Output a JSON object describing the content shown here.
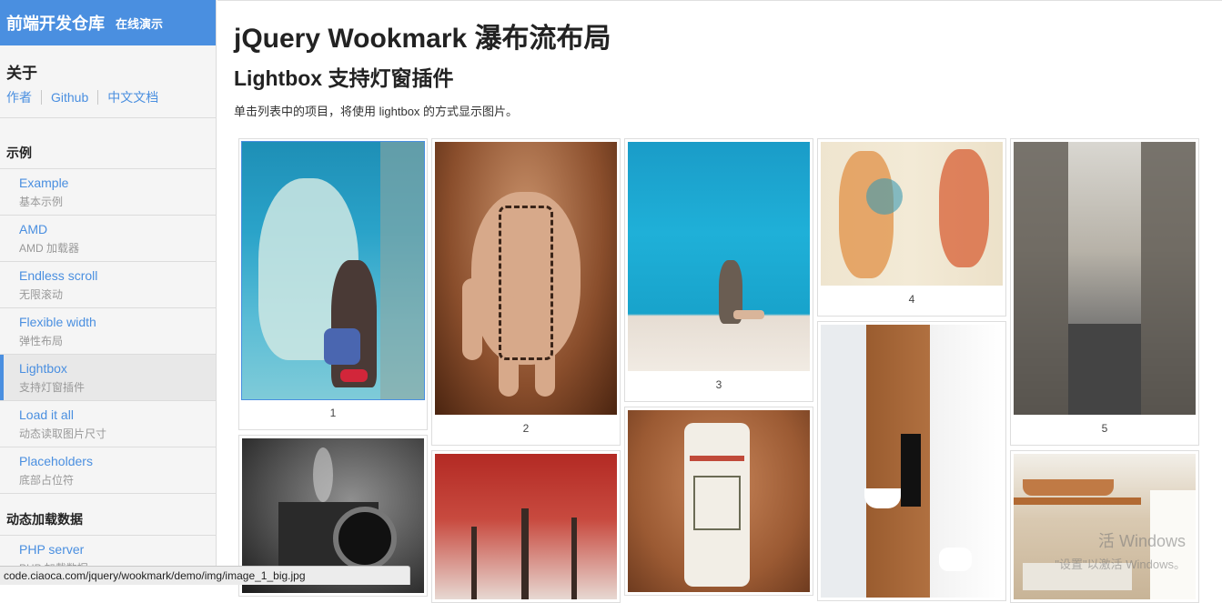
{
  "brand": {
    "title": "前端开发仓库",
    "subtitle": "在线演示"
  },
  "about": {
    "title": "关于",
    "links": [
      "作者",
      "Github",
      "中文文档"
    ]
  },
  "sections": [
    {
      "title": "示例"
    },
    {
      "title": "动态加载数据"
    }
  ],
  "nav": [
    {
      "title": "Example",
      "sub": "基本示例"
    },
    {
      "title": "AMD",
      "sub": "AMD 加载器"
    },
    {
      "title": "Endless scroll",
      "sub": "无限滚动"
    },
    {
      "title": "Flexible width",
      "sub": "弹性布局"
    },
    {
      "title": "Lightbox",
      "sub": "支持灯窗插件"
    },
    {
      "title": "Load it all",
      "sub": "动态读取图片尺寸"
    },
    {
      "title": "Placeholders",
      "sub": "底部占位符"
    },
    {
      "title": "PHP server",
      "sub": "PHP 加载数据"
    }
  ],
  "main": {
    "title": "jQuery Wookmark 瀑布流布局",
    "subtitle": "Lightbox 支持灯窗插件",
    "description": "单击列表中的项目，将使用 lightbox 的方式显示图片。"
  },
  "tiles": [
    "1",
    "2",
    "3",
    "4",
    "5"
  ],
  "status_url": "code.ciaoca.com/jquery/wookmark/demo/img/image_1_big.jpg",
  "watermark": {
    "line1": "活 Windows",
    "line2": "\"设置\"以激活 Windows。"
  },
  "colors": {
    "accent": "#4a8fe0",
    "sidebar_bg": "#f5f5f5"
  }
}
